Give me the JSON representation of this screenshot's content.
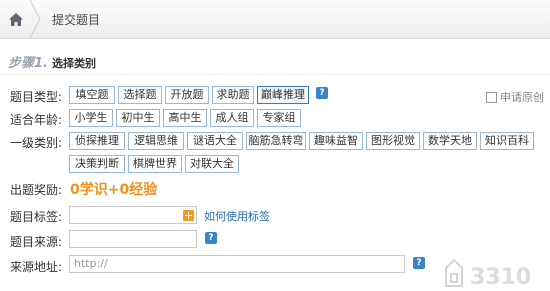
{
  "breadcrumb": {
    "home_icon": "home-icon",
    "current": "提交题目"
  },
  "step": {
    "number": "步骤1.",
    "title": "选择类别"
  },
  "question_type": {
    "label": "题目类型:",
    "options": [
      "填空题",
      "选择题",
      "开放题",
      "求助题",
      "巅峰推理"
    ],
    "selected": "巅峰推理"
  },
  "original_apply": {
    "label": "申请原创",
    "checked": false
  },
  "age": {
    "label": "适合年龄:",
    "options": [
      "小学生",
      "初中生",
      "高中生",
      "成人组",
      "专家组"
    ]
  },
  "category": {
    "label": "一级类别:",
    "options_row1": [
      "侦探推理",
      "逻辑思维",
      "谜语大全",
      "脑筋急转弯",
      "趣味益智",
      "图形视觉",
      "数学天地",
      "知识百科"
    ],
    "options_row2": [
      "决策判断",
      "棋牌世界",
      "对联大全"
    ]
  },
  "reward": {
    "label": "出题奖励:",
    "value": "0学识+0经验"
  },
  "tags": {
    "label": "题目标签:",
    "value": "",
    "help_link": "如何使用标签"
  },
  "source": {
    "label": "题目来源:",
    "value": ""
  },
  "source_url": {
    "label": "来源地址:",
    "placeholder": "http://"
  },
  "watermark": {
    "text": "3310"
  },
  "colors": {
    "accent": "#f0911c",
    "link": "#2a6eb5",
    "option_border": "#9ab8d6",
    "help_bg": "#3b84c7"
  }
}
